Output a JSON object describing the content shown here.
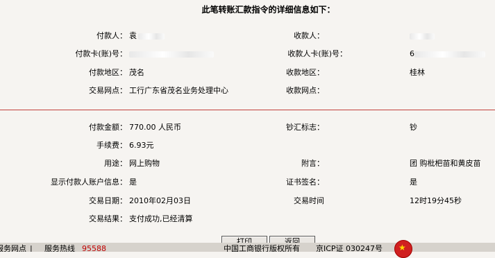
{
  "title": "此笔转账汇款指令的详细信息如下：",
  "payer": {
    "name_label": "付款人：",
    "name_value": "袁",
    "card_label": "付款卡(账)号：",
    "region_label": "付款地区：",
    "region_value": "茂名",
    "branch_label": "交易网点：",
    "branch_value": "工行广东省茂名业务处理中心"
  },
  "payee": {
    "name_label": "收款人：",
    "card_label": "收款人卡(账)号：",
    "card_prefix": "6",
    "region_label": "收款地区：",
    "region_value": "桂林",
    "branch_label": "收款网点："
  },
  "details": {
    "amount_label": "付款金额：",
    "amount_value": "770.00 人民币",
    "fee_label": "手续费：",
    "fee_value": "6.93元",
    "currency_flag_label": "钞汇标志：",
    "currency_flag_value": "钞",
    "purpose_label": "用途：",
    "purpose_value": "网上购物",
    "memo_label": "附言：",
    "memo_value": "团 购枇杷苗和黄皮苗",
    "show_account_label": "显示付款人账户信息：",
    "show_account_value": "是",
    "cert_sign_label": "证书签名：",
    "cert_sign_value": "是",
    "date_label": "交易日期：",
    "date_value": "2010年02月03日",
    "time_label": "交易时间",
    "time_value": "12时19分45秒",
    "result_label": "交易结果：",
    "result_value": "支付成功,已经清算"
  },
  "buttons": {
    "print": "打印",
    "back": "返回"
  },
  "footer": {
    "outlets": "服务网点",
    "separator": "|",
    "hotline_label": "服务热线",
    "hotline_number": "95588",
    "copyright": "中国工商银行版权所有",
    "icp": "京ICP证 030247号"
  }
}
